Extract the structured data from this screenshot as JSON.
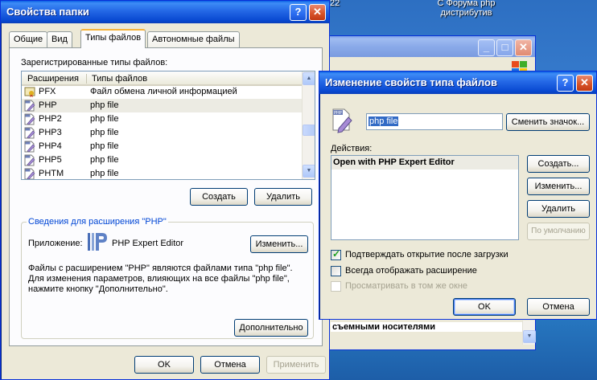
{
  "desktop": {
    "top_text_1": "22",
    "top_text_2": "С Форума php\nдистрибутив"
  },
  "folder_options": {
    "title": "Свойства папки",
    "tabs": [
      "Общие",
      "Вид",
      "Типы файлов",
      "Автономные файлы"
    ],
    "registered_label": "Зарегистрированные типы файлов:",
    "columns": [
      "Расширения",
      "Типы файлов"
    ],
    "rows": [
      {
        "ext": "PFX",
        "type": "Файл обмена личной информацией",
        "icon": "certificate-icon"
      },
      {
        "ext": "PHP",
        "type": "php file",
        "icon": "php-file-icon"
      },
      {
        "ext": "PHP2",
        "type": "php file",
        "icon": "php-file-icon"
      },
      {
        "ext": "PHP3",
        "type": "php file",
        "icon": "php-file-icon"
      },
      {
        "ext": "PHP4",
        "type": "php file",
        "icon": "php-file-icon"
      },
      {
        "ext": "PHP5",
        "type": "php file",
        "icon": "php-file-icon"
      },
      {
        "ext": "PHTM",
        "type": "php file",
        "icon": "php-file-icon"
      }
    ],
    "selected_row": 1,
    "create_button": "Создать",
    "delete_button": "Удалить",
    "details_title": "Сведения для расширения \"PHP\"",
    "app_label": "Приложение:",
    "app_name": "PHP Expert Editor",
    "change_button": "Изменить...",
    "description": "Файлы с расширением \"PHP\" являются файлами типа \"php file\".\nДля изменения параметров, влияющих на все файлы \"php file\",\nнажмите кнопку \"Дополнительно\".",
    "advanced_button": "Дополнительно",
    "ok": "OK",
    "cancel": "Отмена",
    "apply": "Применить"
  },
  "background_window": {
    "fragment_text": "съемными носителями",
    "logo": "windows-flag-icon"
  },
  "edit_type": {
    "title": "Изменение свойств типа файлов",
    "name_value": "php file",
    "change_icon_button": "Сменить значок...",
    "actions_label": "Действия:",
    "actions": [
      "Open with PHP Expert Editor"
    ],
    "create_button": "Создать...",
    "edit_button": "Изменить...",
    "delete_button": "Удалить",
    "default_button": "По умолчанию",
    "confirm_open": "Подтверждать открытие после загрузки",
    "always_show_ext": "Всегда отображать расширение",
    "browse_same_window": "Просматривать в том же окне",
    "ok": "OK",
    "cancel": "Отмена"
  },
  "colors": {
    "selection": "#316ac5",
    "group_title": "#0046d5",
    "title_bar": "#0a4fd4"
  }
}
